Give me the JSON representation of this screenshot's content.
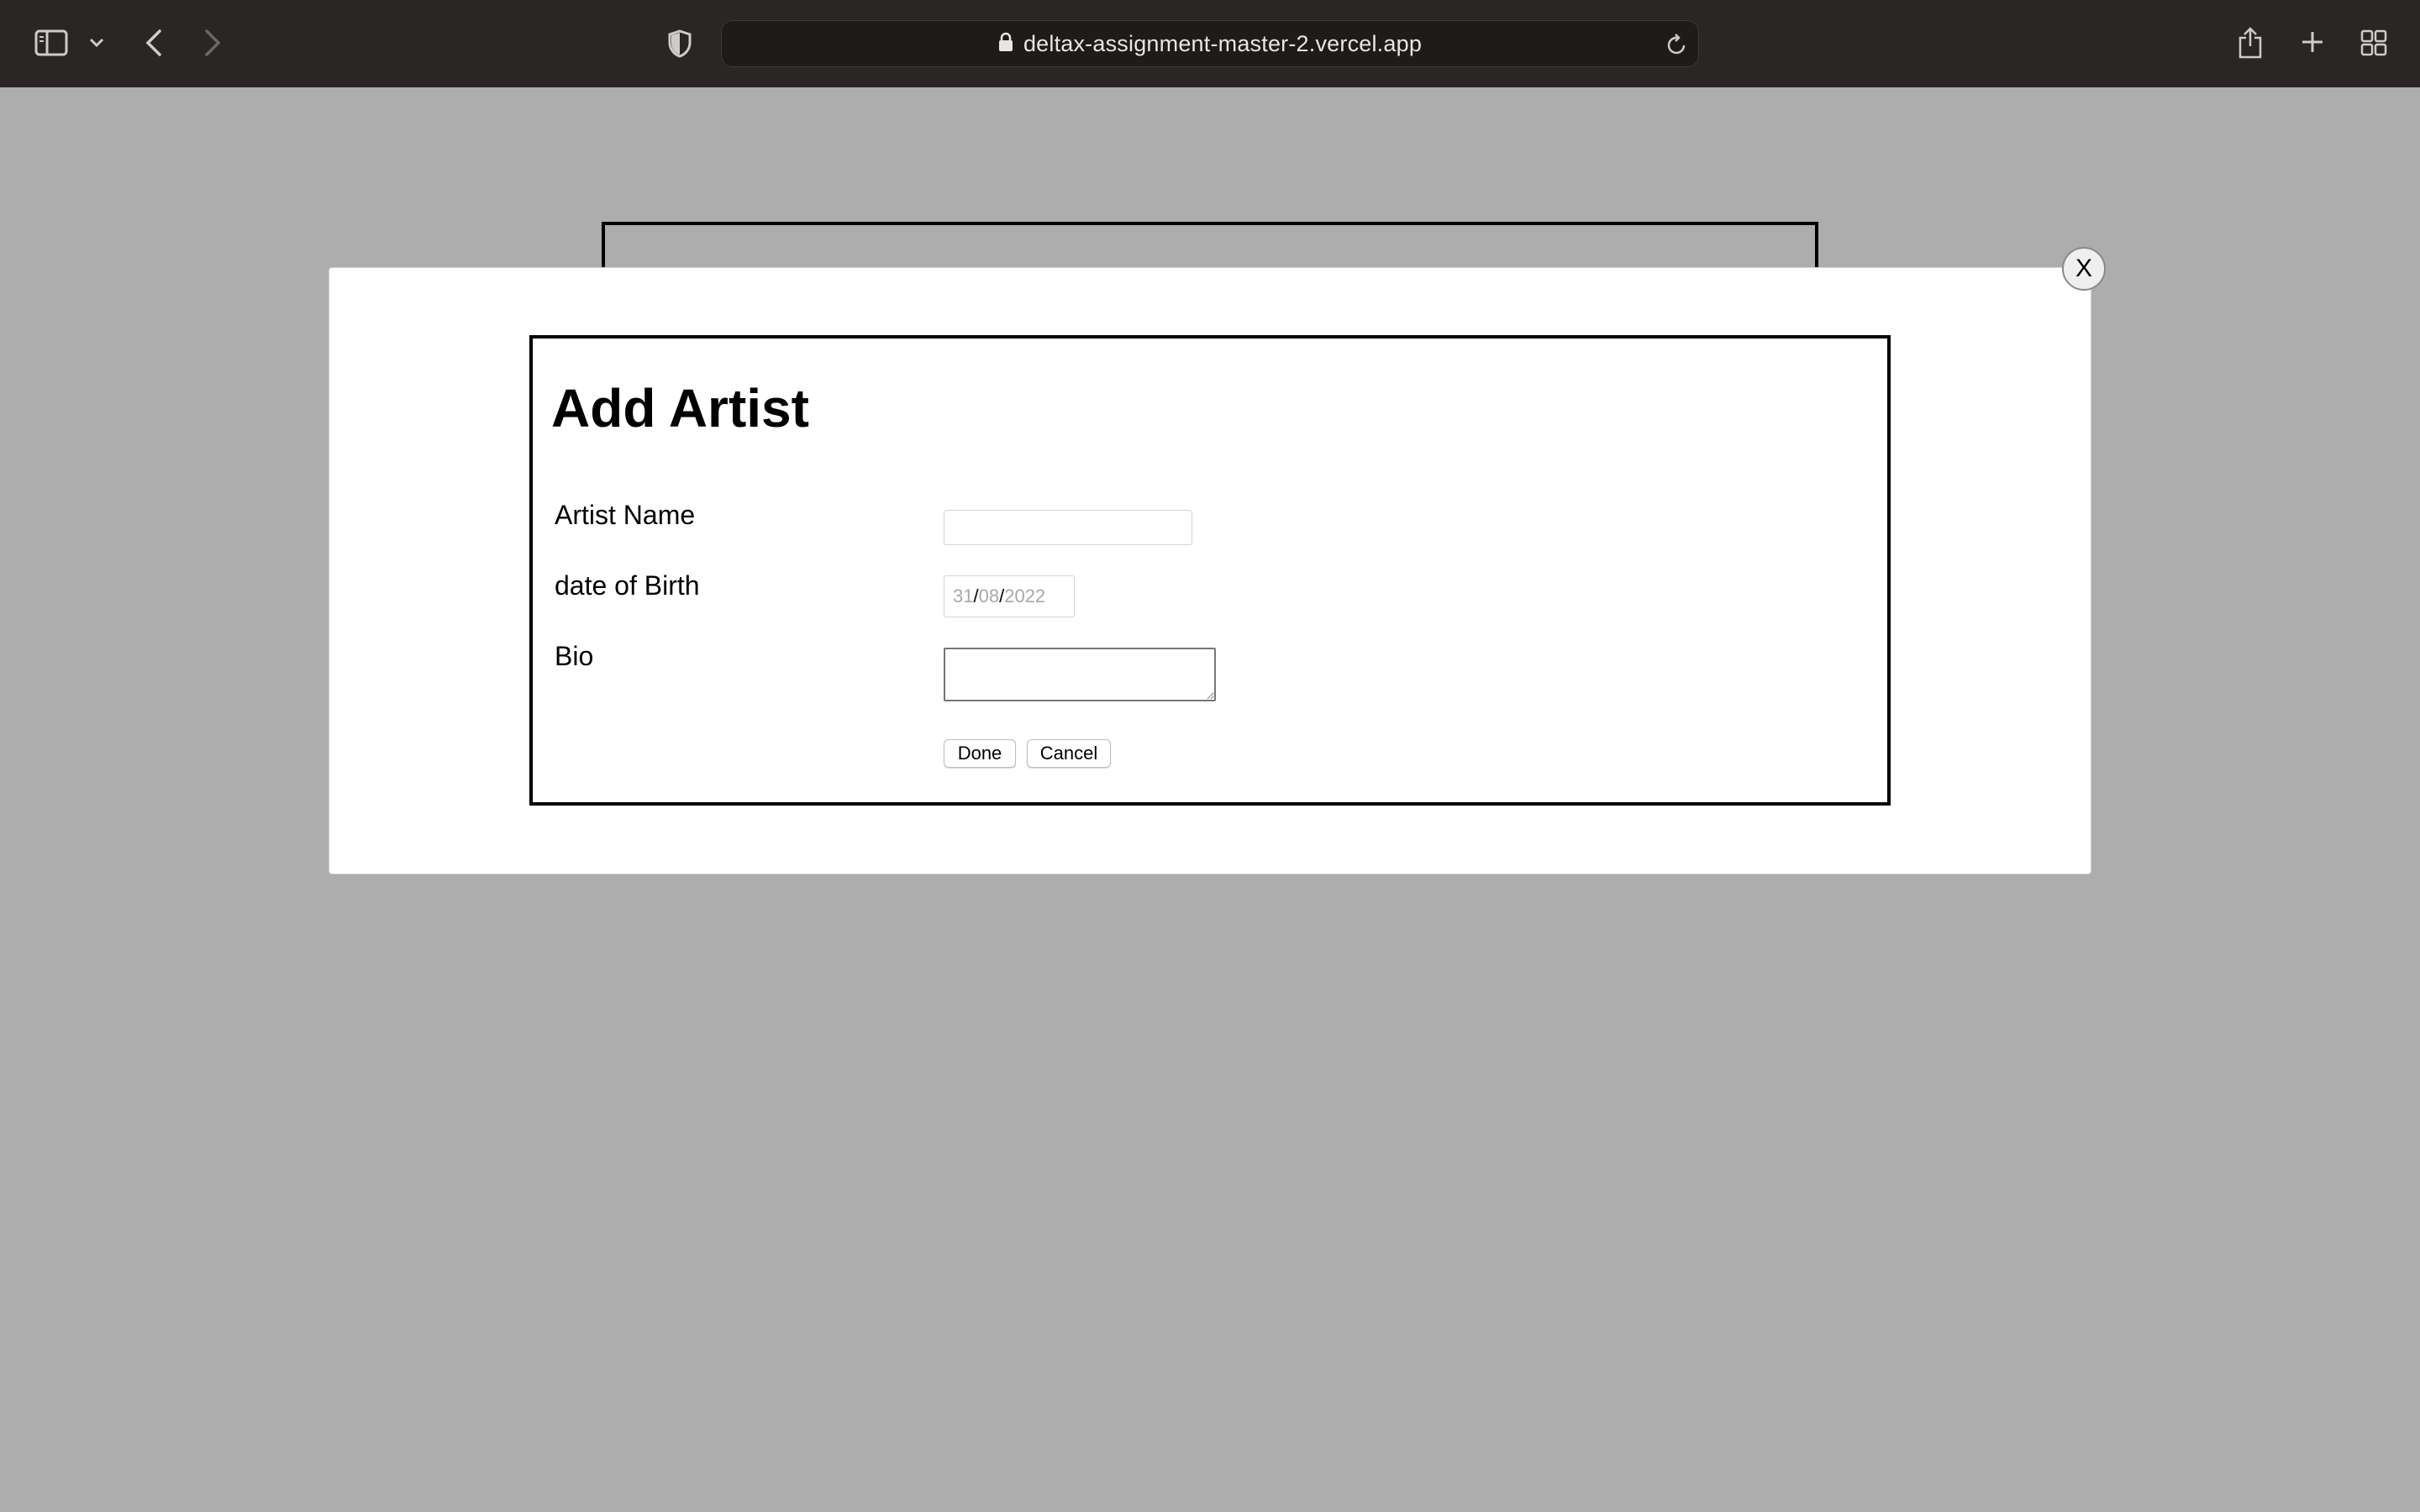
{
  "browser": {
    "url": "deltax-assignment-master-2.vercel.app"
  },
  "modal": {
    "close_label": "X",
    "form": {
      "title": "Add Artist",
      "fields": {
        "artist_name": {
          "label": "Artist Name",
          "value": ""
        },
        "date_of_birth": {
          "label": "date of Birth",
          "day": "31",
          "month": "08",
          "year": "2022",
          "separator": "/"
        },
        "bio": {
          "label": "Bio",
          "value": ""
        }
      },
      "buttons": {
        "done": "Done",
        "cancel": "Cancel"
      }
    }
  }
}
